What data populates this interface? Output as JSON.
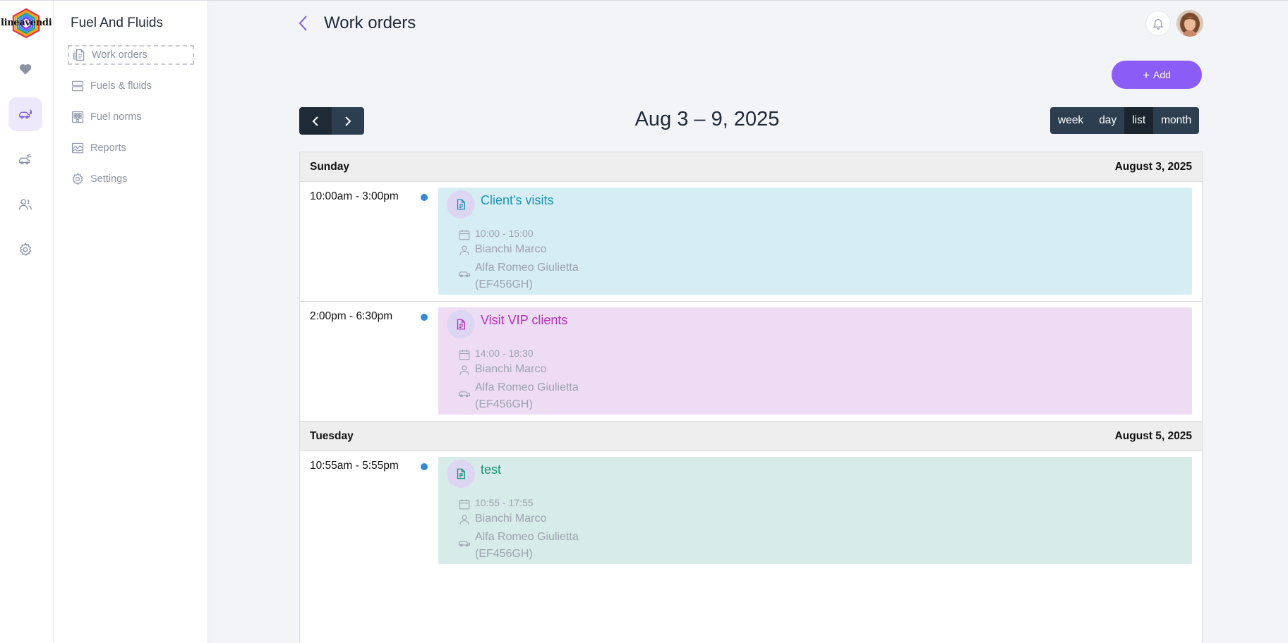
{
  "logo": {
    "text": "lineavendite"
  },
  "rail": {
    "items": [
      {
        "icon": "heart-icon"
      },
      {
        "icon": "car-fuel-icon",
        "active": true
      },
      {
        "icon": "car-speed-icon"
      },
      {
        "icon": "users-icon"
      },
      {
        "icon": "gear-icon"
      }
    ]
  },
  "submenu": {
    "title": "Fuel And Fluids",
    "items": [
      {
        "label": "Work orders",
        "icon": "document-icon",
        "active": true
      },
      {
        "label": "Fuels & fluids",
        "icon": "server-icon"
      },
      {
        "label": "Fuel norms",
        "icon": "building-icon"
      },
      {
        "label": "Reports",
        "icon": "chart-area-icon"
      },
      {
        "label": "Settings",
        "icon": "gear-icon"
      }
    ]
  },
  "header": {
    "title": "Work orders"
  },
  "actions": {
    "add_label": "Add"
  },
  "calendar": {
    "range": "Aug 3 – 9, 2025",
    "views": [
      "week",
      "day",
      "list",
      "month"
    ],
    "active_view": "list",
    "days": [
      {
        "weekday": "Sunday",
        "date": "August 3, 2025",
        "events": [
          {
            "time": "10:00am - 3:00pm",
            "title": "Client's visits",
            "hours": "10:00 - 15:00",
            "driver": "Bianchi Marco",
            "vehicle_line1": "Alfa Romeo Giulietta",
            "vehicle_line2": "(EF456GH)",
            "bg_color": "#d6edf3",
            "title_color": "#1b93b7"
          },
          {
            "time": "2:00pm - 6:30pm",
            "title": "Visit VIP clients",
            "hours": "14:00 - 18:30",
            "driver": "Bianchi Marco",
            "vehicle_line1": "Alfa Romeo Giulietta",
            "vehicle_line2": "(EF456GH)",
            "bg_color": "#eedcf4",
            "title_color": "#b432b8"
          }
        ]
      },
      {
        "weekday": "Tuesday",
        "date": "August 5, 2025",
        "events": [
          {
            "time": "10:55am - 5:55pm",
            "title": "test",
            "hours": "10:55 - 17:55",
            "driver": "Bianchi Marco",
            "vehicle_line1": "Alfa Romeo Giulietta",
            "vehicle_line2": "(EF456GH)",
            "bg_color": "#d7ebe8",
            "title_color": "#13946a"
          }
        ]
      }
    ]
  },
  "colors": {
    "accent": "#8b5cf6",
    "toolbar": "#2c3e50",
    "event_dot": "#3788d8"
  }
}
